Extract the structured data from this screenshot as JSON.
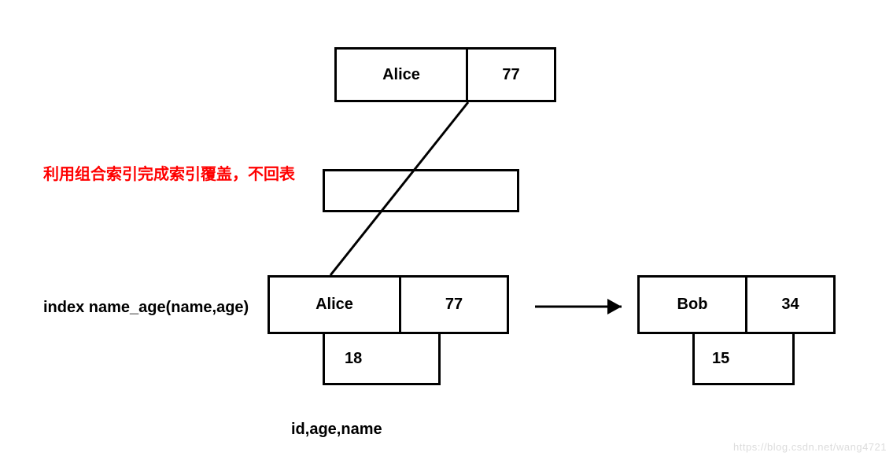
{
  "top_node": {
    "name": "Alice",
    "age": "77"
  },
  "caption_red": "利用组合索引完成索引覆盖，不回表",
  "index_label": "index name_age(name,age)",
  "left_leaf": {
    "name": "Alice",
    "age": "77",
    "id": "18"
  },
  "right_leaf": {
    "name": "Bob",
    "age": "34",
    "id": "15"
  },
  "bottom_caption": "id,age,name",
  "watermark": "https://blog.csdn.net/wang4721"
}
